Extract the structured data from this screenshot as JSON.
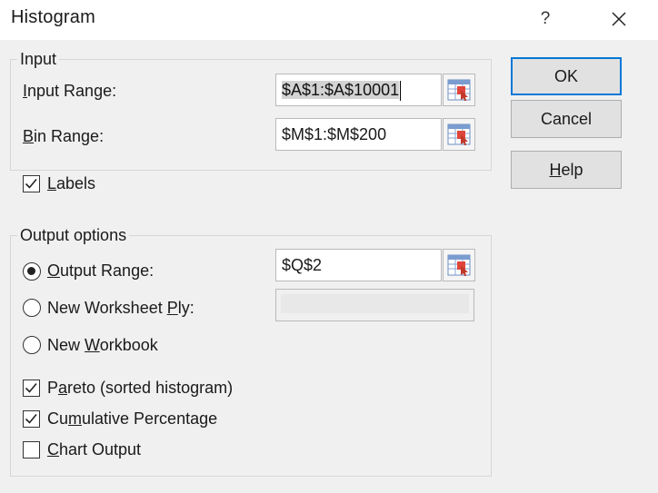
{
  "window": {
    "title": "Histogram",
    "help_glyph": "?",
    "close_glyph": "close-icon"
  },
  "input_group": {
    "title": "Input",
    "input_range": {
      "label_pre": "",
      "label_access": "I",
      "label_post": "nput Range:",
      "value": "$A$1:$A$10001"
    },
    "bin_range": {
      "label_pre": "",
      "label_access": "B",
      "label_post": "in Range:",
      "value": "$M$1:$M$200"
    }
  },
  "labels_checkbox": {
    "label_pre": "",
    "label_access": "L",
    "label_post": "abels",
    "checked": true
  },
  "output_group": {
    "title": "Output options",
    "output_range": {
      "label_pre": "",
      "label_access": "O",
      "label_post": "utput Range:",
      "value": "$Q$2",
      "selected": true
    },
    "new_worksheet": {
      "label_pre": "New Worksheet ",
      "label_access": "P",
      "label_post": "ly:",
      "value": "",
      "selected": false
    },
    "new_workbook": {
      "label_pre": "New ",
      "label_access": "W",
      "label_post": "orkbook",
      "selected": false
    },
    "pareto": {
      "label_pre": "P",
      "label_access": "a",
      "label_post": "reto (sorted histogram)",
      "checked": true
    },
    "cumulative": {
      "label_pre": "Cu",
      "label_access": "m",
      "label_post": "ulative Percentage",
      "checked": true
    },
    "chart_output": {
      "label_pre": "",
      "label_access": "C",
      "label_post": "hart Output",
      "checked": false
    }
  },
  "buttons": {
    "ok": {
      "label_pre": "OK",
      "label_access": "",
      "label_post": ""
    },
    "cancel": {
      "label_pre": "Cancel",
      "label_access": "",
      "label_post": ""
    },
    "help": {
      "label_pre": "",
      "label_access": "H",
      "label_post": "elp"
    }
  },
  "colors": {
    "default_button_border": "#0078d7",
    "selection_highlight": "#d3d3d3"
  }
}
